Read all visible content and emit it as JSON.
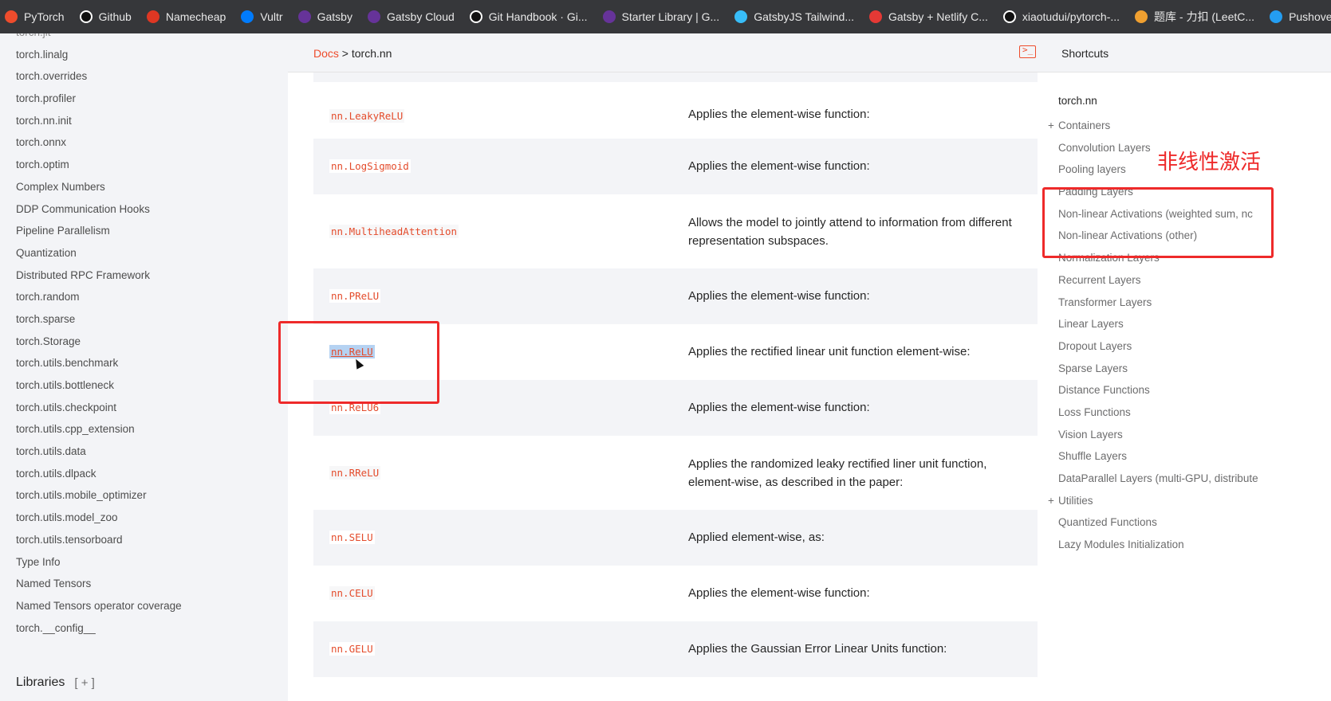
{
  "bookmarks": [
    {
      "label": "PyTorch",
      "icon": "pytorch-icon",
      "color": "#ee4c2c"
    },
    {
      "label": "Github",
      "icon": "github-icon",
      "color": "#ffffff"
    },
    {
      "label": "Namecheap",
      "icon": "namecheap-icon",
      "color": "#de3723"
    },
    {
      "label": "Vultr",
      "icon": "vultr-icon",
      "color": "#007bfc"
    },
    {
      "label": "Gatsby",
      "icon": "gatsby-icon",
      "color": "#663399"
    },
    {
      "label": "Gatsby Cloud",
      "icon": "gatsby-icon",
      "color": "#663399"
    },
    {
      "label": "Git Handbook · Gi...",
      "icon": "github-icon",
      "color": "#ffffff"
    },
    {
      "label": "Starter Library | G...",
      "icon": "gatsby-icon",
      "color": "#663399"
    },
    {
      "label": "GatsbyJS Tailwind...",
      "icon": "tailwind-icon",
      "color": "#38bdf8"
    },
    {
      "label": "Gatsby + Netlify C...",
      "icon": "netlify-icon",
      "color": "#e53935"
    },
    {
      "label": "xiaotudui/pytorch-...",
      "icon": "github-icon",
      "color": "#ffffff"
    },
    {
      "label": "题库 - 力扣 (LeetC...",
      "icon": "leetcode-icon",
      "color": "#f0a030"
    },
    {
      "label": "Pushover: Sim",
      "icon": "pushover-icon",
      "color": "#249df1"
    }
  ],
  "sidebar": {
    "cut_item": "torch.jit",
    "items": [
      "torch.linalg",
      "torch.overrides",
      "torch.profiler",
      "torch.nn.init",
      "torch.onnx",
      "torch.optim",
      "Complex Numbers",
      "DDP Communication Hooks",
      "Pipeline Parallelism",
      "Quantization",
      "Distributed RPC Framework",
      "torch.random",
      "torch.sparse",
      "torch.Storage",
      "torch.utils.benchmark",
      "torch.utils.bottleneck",
      "torch.utils.checkpoint",
      "torch.utils.cpp_extension",
      "torch.utils.data",
      "torch.utils.dlpack",
      "torch.utils.mobile_optimizer",
      "torch.utils.model_zoo",
      "torch.utils.tensorboard",
      "Type Info",
      "Named Tensors",
      "Named Tensors operator coverage",
      "torch.__config__"
    ],
    "libraries_label": "Libraries",
    "libraries_toggle": "[ + ]"
  },
  "header": {
    "breadcrumb_docs": "Docs",
    "breadcrumb_sep": " > ",
    "breadcrumb_current": "torch.nn",
    "terminal_glyph": ">_",
    "shortcuts_label": "Shortcuts"
  },
  "table": {
    "rows": [
      {
        "name": "nn.LeakyReLU",
        "desc": "Applies the element-wise function:"
      },
      {
        "name": "nn.LogSigmoid",
        "desc": "Applies the element-wise function:"
      },
      {
        "name": "nn.MultiheadAttention",
        "desc": "Allows the model to jointly attend to information from different representation subspaces."
      },
      {
        "name": "nn.PReLU",
        "desc": "Applies the element-wise function:"
      },
      {
        "name": "nn.ReLU",
        "desc": "Applies the rectified linear unit function element-wise:"
      },
      {
        "name": "nn.ReLU6",
        "desc": "Applies the element-wise function:"
      },
      {
        "name": "nn.RReLU",
        "desc": "Applies the randomized leaky rectified liner unit function, element-wise, as described in the paper:"
      },
      {
        "name": "nn.SELU",
        "desc": "Applied element-wise, as:"
      },
      {
        "name": "nn.CELU",
        "desc": "Applies the element-wise function:"
      },
      {
        "name": "nn.GELU",
        "desc": "Applies the Gaussian Error Linear Units function:"
      }
    ]
  },
  "toc": {
    "title": "torch.nn",
    "items": [
      {
        "label": "Containers",
        "prefix": "+"
      },
      {
        "label": "Convolution Layers",
        "prefix": ""
      },
      {
        "label": "Pooling layers",
        "prefix": ""
      },
      {
        "label": "Padding Layers",
        "prefix": ""
      },
      {
        "label": "Non-linear Activations (weighted sum, nc",
        "prefix": ""
      },
      {
        "label": "Non-linear Activations (other)",
        "prefix": ""
      },
      {
        "label": "Normalization Layers",
        "prefix": ""
      },
      {
        "label": "Recurrent Layers",
        "prefix": ""
      },
      {
        "label": "Transformer Layers",
        "prefix": ""
      },
      {
        "label": "Linear Layers",
        "prefix": ""
      },
      {
        "label": "Dropout Layers",
        "prefix": ""
      },
      {
        "label": "Sparse Layers",
        "prefix": ""
      },
      {
        "label": "Distance Functions",
        "prefix": ""
      },
      {
        "label": "Loss Functions",
        "prefix": ""
      },
      {
        "label": "Vision Layers",
        "prefix": ""
      },
      {
        "label": "Shuffle Layers",
        "prefix": ""
      },
      {
        "label": "DataParallel Layers (multi-GPU, distribute",
        "prefix": ""
      },
      {
        "label": "Utilities",
        "prefix": "+"
      },
      {
        "label": "Quantized Functions",
        "prefix": ""
      },
      {
        "label": "Lazy Modules Initialization",
        "prefix": ""
      }
    ],
    "annotation": "非线性激活"
  },
  "colors": {
    "accent": "#ee4c2c",
    "annotation_red": "#ee2a2a",
    "selection": "#b5d2f2"
  }
}
